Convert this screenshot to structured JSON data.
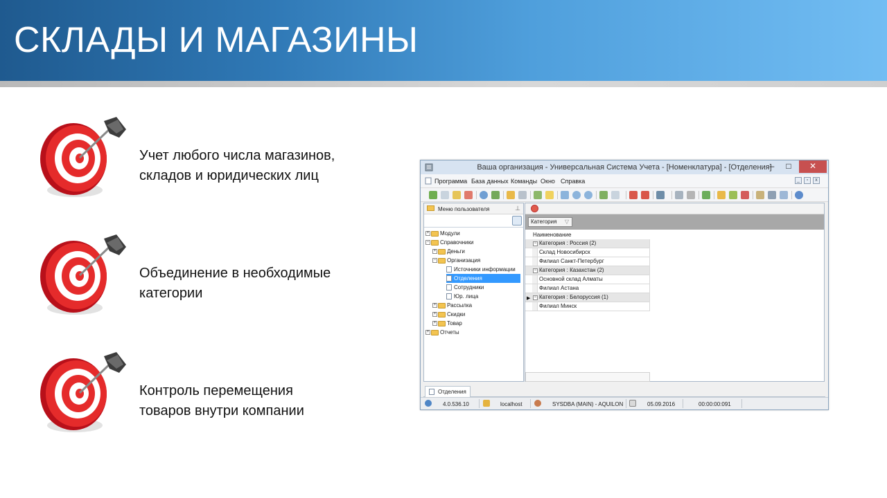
{
  "slide": {
    "title": "СКЛАДЫ И МАГАЗИНЫ",
    "bullets": [
      {
        "line1": "Учет любого числа магазинов,",
        "line2": "складов и юридических лиц",
        "icon": "target-dart-icon"
      },
      {
        "line1": "Объединение в необходимые",
        "line2": "категории",
        "icon": "target-dart-icon"
      },
      {
        "line1": "Контроль перемещения",
        "line2": "товаров внутри компании",
        "icon": "target-dart-icon"
      }
    ]
  },
  "app": {
    "window_title": "Ваша организация - Универсальная Система Учета - [Номенклатура] - [Отделения]",
    "menu": [
      "Программа",
      "База данных",
      "Команды",
      "Окно",
      "Справка"
    ],
    "left_panel": {
      "title": "Меню пользователя",
      "tree": [
        {
          "label": "Модули",
          "level": 0,
          "expander": "+"
        },
        {
          "label": "Справочники",
          "level": 0,
          "expander": "−"
        },
        {
          "label": "Деньги",
          "level": 1,
          "expander": "+"
        },
        {
          "label": "Организация",
          "level": 1,
          "expander": "−"
        },
        {
          "label": "Источники информации",
          "level": 2
        },
        {
          "label": "Отделения",
          "level": 2,
          "selected": true
        },
        {
          "label": "Сотрудники",
          "level": 2
        },
        {
          "label": "Юр. лица",
          "level": 2
        },
        {
          "label": "Рассылка",
          "level": 1,
          "expander": "+"
        },
        {
          "label": "Скидки",
          "level": 1,
          "expander": "+"
        },
        {
          "label": "Товар",
          "level": 1,
          "expander": "+"
        },
        {
          "label": "Отчеты",
          "level": 0,
          "expander": "+"
        }
      ]
    },
    "grid": {
      "group_by_chip": "Категория",
      "column_header": "Наименование",
      "rows": [
        {
          "type": "group",
          "text": "Категория : Россия (2)"
        },
        {
          "type": "item",
          "text": "Склад Новосибирск"
        },
        {
          "type": "item",
          "text": "Филиал Санкт-Петербург"
        },
        {
          "type": "group",
          "text": "Категория : Казахстан (2)"
        },
        {
          "type": "item",
          "text": "Основной склад Алматы"
        },
        {
          "type": "item",
          "text": "Филиал Астана"
        },
        {
          "type": "group",
          "text": "Категория : Белоруссия (1)",
          "current": true
        },
        {
          "type": "item",
          "text": "Филиал Минск"
        }
      ]
    },
    "bottom_tab": "Отделения",
    "status": {
      "version": "4.0.536.10",
      "host": "localhost",
      "user": "SYSDBA (MAIN) - AQUILON",
      "date": "05.09.2016",
      "timer": "00:00:00:091"
    }
  },
  "colors": {
    "header_dark": "#1f5a8f",
    "header_light": "#72bdf3",
    "selection": "#3399ff",
    "close_button": "#c75050"
  }
}
